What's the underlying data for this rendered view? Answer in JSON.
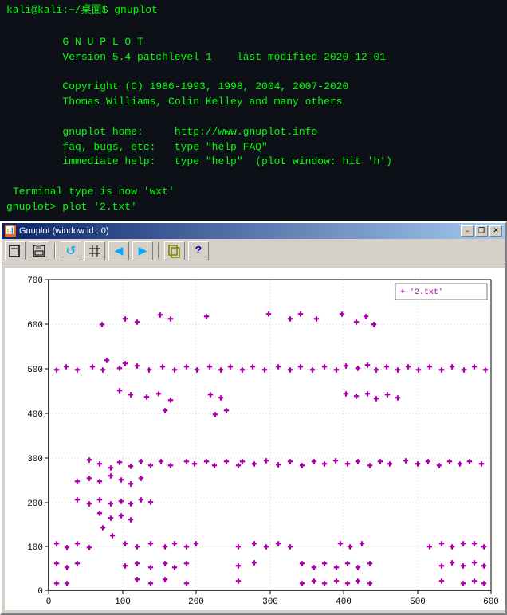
{
  "terminal": {
    "prompt_line": "kali@kali:~/桌面$ gnuplot",
    "lines": [
      "",
      "        G N U P L O T",
      "        Version 5.4 patchlevel 1    last modified 2020-12-01",
      "",
      "        Copyright (C) 1986-1993, 1998, 2004, 2007-2020",
      "        Thomas Williams, Colin Kelley and many others",
      "",
      "        gnuplot home:     http://www.gnuplot.info",
      "        faq, bugs, etc:   type \"help FAQ\"",
      "        immediate help:   type \"help\"  (plot window: hit 'h')",
      "",
      "Terminal type is now 'wxt'",
      "gnuplot> plot '2.txt'"
    ]
  },
  "plot_window": {
    "title": "Gnuplot (window id : 0)",
    "minimize_label": "−",
    "restore_label": "❐",
    "close_label": "✕",
    "icon_label": "📊",
    "toolbar_buttons": [
      {
        "icon": "⬜",
        "name": "new"
      },
      {
        "icon": "💾",
        "name": "save"
      },
      {
        "icon": "↺",
        "name": "revert"
      },
      {
        "icon": "⊞",
        "name": "grid"
      },
      {
        "icon": "↩",
        "name": "back"
      },
      {
        "icon": "↪",
        "name": "forward"
      },
      {
        "icon": "✏",
        "name": "edit"
      },
      {
        "icon": "?",
        "name": "help"
      }
    ],
    "legend_label": "'2.txt'",
    "y_axis_max": 700,
    "y_axis_min": 0,
    "x_axis_max": 600,
    "x_axis_min": 0,
    "y_ticks": [
      0,
      100,
      200,
      300,
      400,
      500,
      600,
      700
    ],
    "x_ticks": [
      0,
      100,
      200,
      300,
      400,
      500,
      600
    ]
  }
}
